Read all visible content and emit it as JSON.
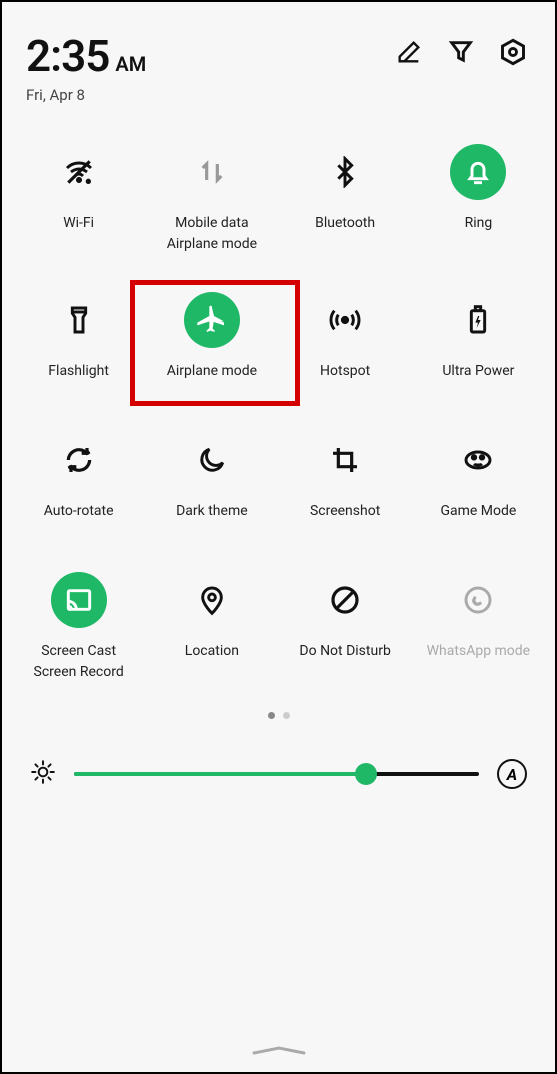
{
  "header": {
    "time": "2:35",
    "ampm": "AM",
    "date": "Fri, Apr 8"
  },
  "tiles": {
    "wifi": {
      "label": "Wi-Fi"
    },
    "mobiledata": {
      "label": "Mobile data",
      "sublabel": "Airplane mode"
    },
    "bluetooth": {
      "label": "Bluetooth"
    },
    "ring": {
      "label": "Ring"
    },
    "flashlight": {
      "label": "Flashlight"
    },
    "airplane": {
      "label": "Airplane mode"
    },
    "hotspot": {
      "label": "Hotspot"
    },
    "ultrapower": {
      "label": "Ultra Power"
    },
    "autorotate": {
      "label": "Auto-rotate"
    },
    "darktheme": {
      "label": "Dark theme"
    },
    "screenshot": {
      "label": "Screenshot"
    },
    "gamemode": {
      "label": "Game Mode"
    },
    "screencast": {
      "label": "Screen Cast",
      "sublabel": "Screen Record"
    },
    "location": {
      "label": "Location"
    },
    "dnd": {
      "label": "Do Not Disturb"
    },
    "whatsapp": {
      "label": "WhatsApp mode"
    }
  },
  "brightness": {
    "value_percent": 72,
    "auto_label": "A"
  },
  "colors": {
    "accent": "#1fb866",
    "highlight": "#d40000"
  }
}
